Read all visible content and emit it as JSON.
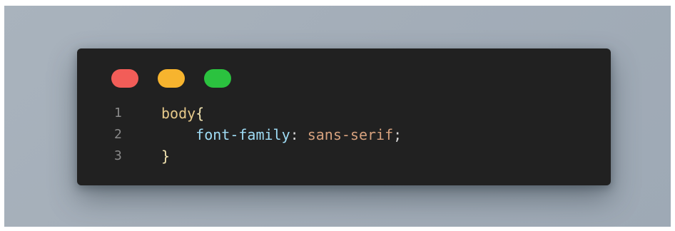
{
  "window_controls": {
    "close_color": "#f25d58",
    "minimize_color": "#f7b42e",
    "maximize_color": "#2bc23f"
  },
  "code": {
    "lines": [
      {
        "number": "1",
        "selector": "body",
        "open_brace": "{"
      },
      {
        "number": "2",
        "property": "font-family",
        "colon": ":",
        "value": "sans-serif",
        "semicolon": ";"
      },
      {
        "number": "3",
        "close_brace": "}"
      }
    ]
  }
}
